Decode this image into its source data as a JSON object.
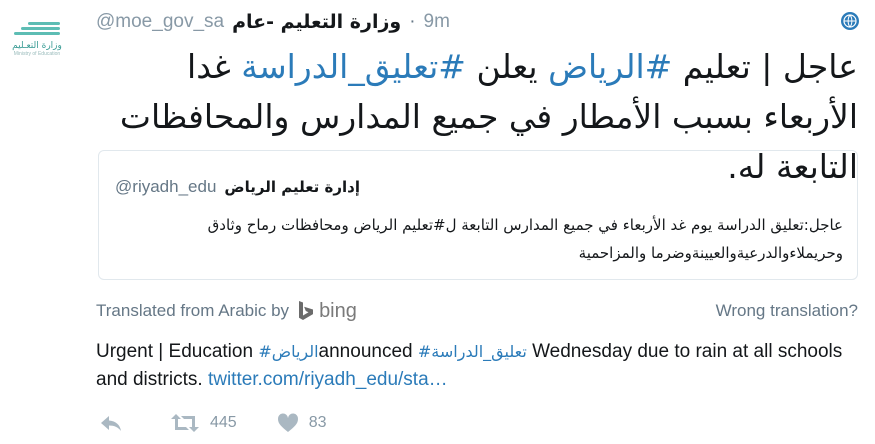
{
  "avatar": {
    "brand": "وزارة التعـليم",
    "sub": "Ministry of Education"
  },
  "header": {
    "name": "وزارة التعليم -عام",
    "handle": "@moe_gov_sa",
    "separator": "·",
    "time": "9m"
  },
  "icons": {
    "globe": "globe-icon",
    "reply": "reply-icon",
    "retweet": "retweet-icon",
    "like": "heart-icon",
    "bing": "bing-logo-icon"
  },
  "tweet": {
    "t1": "عاجل | تعليم ",
    "tag1": "#الرياض",
    "t2": " يعلن ",
    "tag2": "#تعليق_الدراسة",
    "t3": " غدا الأربعاء بسبب الأمطار في جميع المدارس والمحافظات التابعة له."
  },
  "quote": {
    "name": "إدارة تعليم الرياض",
    "handle": "@riyadh_edu",
    "text": "عاجل:تعليق الدراسة يوم غد الأربعاء في جميع المدارس التابعة ل#تعليم الرياض ومحافظات رماح وثادق وحريملاءوالدرعيةوالعيينةوضرما والمزاحمية"
  },
  "translation_bar": {
    "label": "Translated from Arabic by",
    "provider": "bing",
    "wrong": "Wrong translation?"
  },
  "translation": {
    "p1": "Urgent | Education ",
    "tag1": "#الرياض",
    "p2": "announced ",
    "tag2": "#تعليق_الدراسة",
    "p3": "  Wednesday due to rain at all schools and districts. ",
    "link": "twitter.com/riyadh_edu/sta…"
  },
  "actions": {
    "retweets": "445",
    "likes": "83"
  },
  "colors": {
    "link": "#2b7bb9",
    "muted": "#8899a6",
    "border": "#e1e8ed"
  }
}
